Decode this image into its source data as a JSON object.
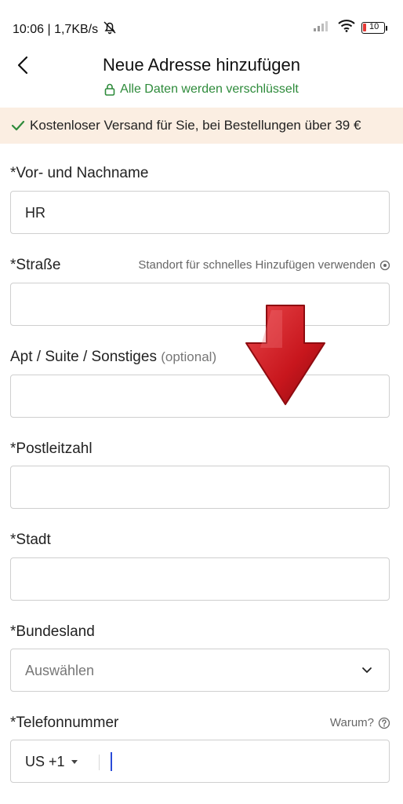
{
  "status_bar": {
    "time_speed": "10:06 | 1,7KB/s",
    "battery": "10"
  },
  "header": {
    "title": "Neue Adresse hinzufügen",
    "secure_text": "Alle Daten werden verschlüsselt"
  },
  "banner": {
    "text": "Kostenloser Versand für Sie, bei Bestellungen über 39 €"
  },
  "form": {
    "name": {
      "req": "*",
      "label": "Vor- und Nachname",
      "value": "HR"
    },
    "street": {
      "req": "*",
      "label": "Straße",
      "location_hint": "Standort für schnelles Hinzufügen verwenden"
    },
    "apt": {
      "label": "Apt / Suite / Sonstiges",
      "optional": "(optional)"
    },
    "zip": {
      "req": "*",
      "label": "Postleitzahl"
    },
    "city": {
      "req": "*",
      "label": "Stadt"
    },
    "state": {
      "req": "*",
      "label": "Bundesland",
      "placeholder": "Auswählen"
    },
    "phone": {
      "req": "*",
      "label": "Telefonnummer",
      "why": "Warum?",
      "code": "US +1"
    }
  },
  "colors": {
    "green": "#2e8b3b",
    "banner_bg": "#fbeee2",
    "arrow_red": "#c8161d",
    "cursor": "#2a4bd8"
  }
}
